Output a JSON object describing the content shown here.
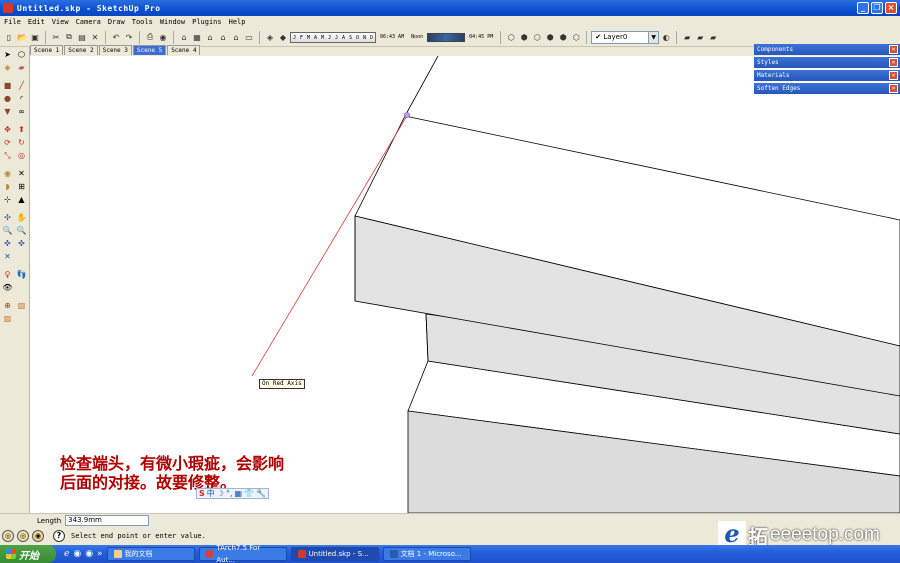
{
  "window": {
    "title": "Untitled.skp - SketchUp Pro"
  },
  "menu": [
    "File",
    "Edit",
    "View",
    "Camera",
    "Draw",
    "Tools",
    "Window",
    "Plugins",
    "Help"
  ],
  "shadows": {
    "months": [
      "J",
      "F",
      "M",
      "A",
      "M",
      "J",
      "J",
      "A",
      "S",
      "O",
      "N",
      "D"
    ],
    "time_start": "06:43 AM",
    "time_noon": "Noon",
    "time_end": "04:45 PM"
  },
  "layer": {
    "current": "Layer0"
  },
  "scenes": [
    {
      "label": "Scene 1",
      "active": false
    },
    {
      "label": "Scene 2",
      "active": false
    },
    {
      "label": "Scene 3",
      "active": false
    },
    {
      "label": "Scene 5",
      "active": true
    },
    {
      "label": "Scene 4",
      "active": false
    }
  ],
  "tray": [
    {
      "label": "Components"
    },
    {
      "label": "Styles"
    },
    {
      "label": "Materials"
    },
    {
      "label": "Soften Edges"
    }
  ],
  "viewport": {
    "inference_tooltip": "On Red Axis",
    "annotation_line1": "检查端头，有微小瑕疵，会影响",
    "annotation_line2": "后面的对接。故要修整。",
    "ime": [
      "S",
      "中",
      "☽",
      "°,",
      "▦",
      "👕",
      "🔧"
    ]
  },
  "status": {
    "measure_label": "Length",
    "measure_value": "343.9mm",
    "message": "Select end point or enter value."
  },
  "watermark": {
    "brand": "拓",
    "site": "eeeetop.com"
  },
  "taskbar": {
    "start": "开始",
    "tasks": [
      {
        "label": "我的文档",
        "active": false
      },
      {
        "label": "TArch7.5 For Aut...",
        "active": false
      },
      {
        "label": "Untitled.skp - S...",
        "active": true
      },
      {
        "label": "文档 1 - Microso...",
        "active": false
      }
    ]
  }
}
